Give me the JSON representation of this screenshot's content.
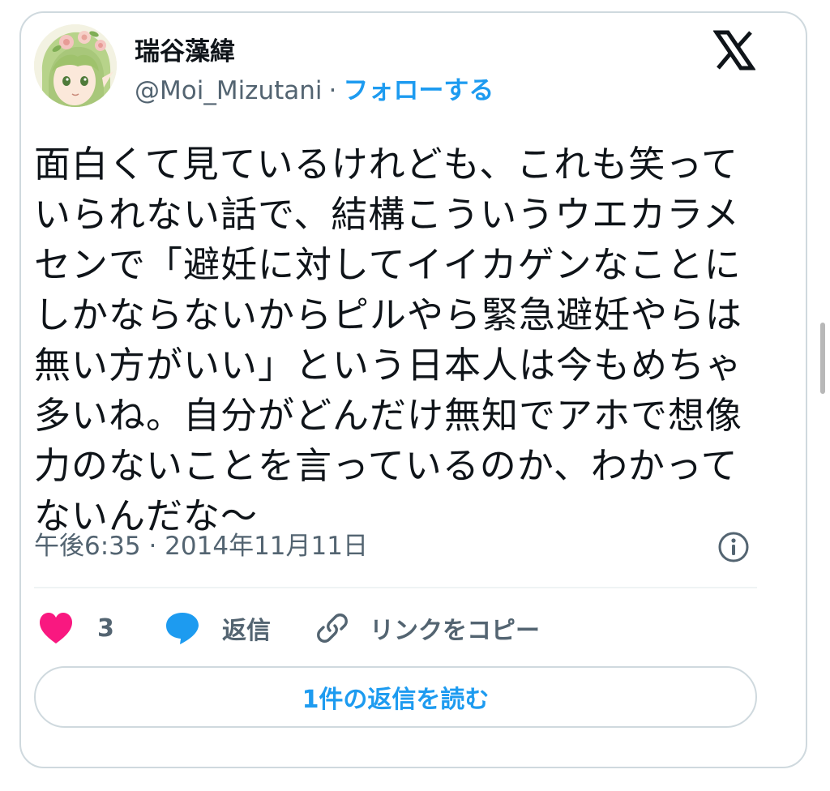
{
  "author": {
    "name": "瑞谷藻緯",
    "handle": "@Moi_Mizutani",
    "separator": "·",
    "follow_label": "フォローする"
  },
  "brand": {
    "logo_icon": "x-logo-icon",
    "color": "#0f1419"
  },
  "tweet": {
    "lines": [
      "面白くて見ているけれども、これも笑って",
      "いられない話で、結構こういうウエカラメ",
      "センで「避妊に対してイイカゲンなことに",
      "しかならないからピルやら緊急避妊やらは",
      "無い方がいい」という日本人は今もめちゃ",
      "多いね。自分がどんだけ無知でアホで想像",
      "力のないことを言っているのか、わかって",
      "ないんだな〜"
    ],
    "timestamp": "午後6:35 · 2014年11月11日"
  },
  "actions": {
    "like": {
      "icon": "heart-icon",
      "count": "3",
      "color": "#f91880"
    },
    "reply": {
      "icon": "speech-bubble-icon",
      "label": "返信",
      "color": "#1d9bf0"
    },
    "copy_link": {
      "icon": "link-icon",
      "label": "リンクをコピー"
    }
  },
  "read_replies_label": "1件の返信を読む",
  "colors": {
    "accent": "#1d9bf0",
    "secondary_text": "#536471",
    "border": "#cfd9de"
  }
}
